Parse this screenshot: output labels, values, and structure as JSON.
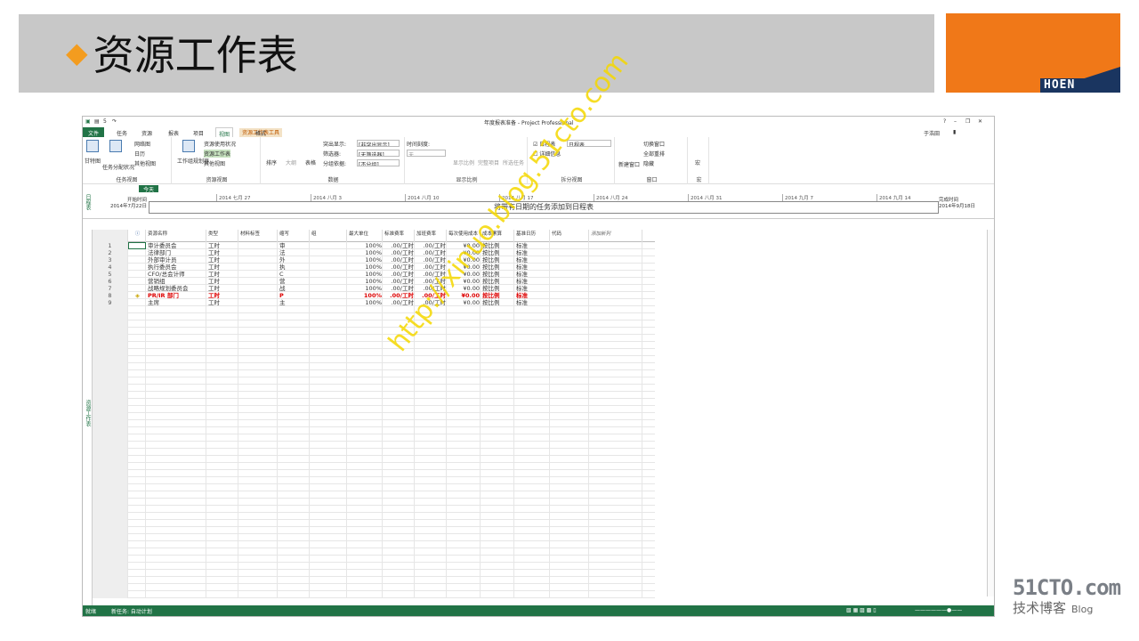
{
  "slide_title": "资源工作表",
  "logo_text": "HOEN",
  "window": {
    "title": "年度报表准备 - Project Professional",
    "help": "?",
    "user": "于浩田",
    "qat_undo": "5",
    "context_tab": "资源工作表工具"
  },
  "tabs": [
    "文件",
    "任务",
    "资源",
    "报表",
    "项目",
    "视图",
    "格式"
  ],
  "active_tab": "视图",
  "ribbon": {
    "groups": [
      {
        "label": "任务视图",
        "items": [
          "甘特图",
          "任务分配状况",
          "网络图",
          "日历",
          "其他视图"
        ]
      },
      {
        "label": "资源视图",
        "items": [
          "工作组规划器",
          "资源使用状况",
          "资源工作表",
          "其他视图"
        ]
      },
      {
        "label": "数据",
        "items": [
          "排序",
          "大纲",
          "表格",
          "突出显示:",
          "筛选器:",
          "分组依据:"
        ]
      },
      {
        "label": "显示比例",
        "items": [
          "时间刻度:",
          "天",
          "显示比例",
          "完整项目",
          "所选任务"
        ]
      },
      {
        "label": "拆分视图",
        "items": [
          "日程表",
          "详细信息"
        ]
      },
      {
        "label": "窗口",
        "items": [
          "新建窗口",
          "切换窗口",
          "全部重排",
          "隐藏"
        ]
      },
      {
        "label": "宏",
        "items": [
          "宏"
        ]
      }
    ],
    "highlight_value": "[非突出显示]",
    "filter_value": "[无筛选器]",
    "group_value": "[不分组]",
    "timeline_value": "日程表"
  },
  "timeline": {
    "today": "今天",
    "start_label": "开始时间",
    "start_date": "2014年7月22日",
    "end_label": "完成时间",
    "end_date": "2014年9月18日",
    "placeholder": "将带有日期的任务添加到日程表",
    "ticks": [
      "2014 七月 27",
      "2014 八月 3",
      "2014 八月 10",
      "2014 八月 17",
      "2014 八月 24",
      "2014 八月 31",
      "2014 九月 7",
      "2014 九月 14"
    ],
    "side_label": "日程表"
  },
  "sheet": {
    "side_label": "资源工作表",
    "columns": [
      "资源名称",
      "类型",
      "材料标签",
      "缩写",
      "组",
      "最大单位",
      "标准费率",
      "加班费率",
      "每次使用成本",
      "成本累算",
      "基准日历",
      "代码",
      "添加新列"
    ],
    "rows": [
      {
        "id": "1",
        "name": "审计委员会",
        "type": "工时",
        "abbr": "审",
        "max": "100%",
        "std": ".00/工时",
        "ot": ".00/工时",
        "cost": "¥0.00",
        "accrue": "按比例",
        "cal": "标准",
        "alert": false
      },
      {
        "id": "2",
        "name": "法律部门",
        "type": "工时",
        "abbr": "法",
        "max": "100%",
        "std": ".00/工时",
        "ot": ".00/工时",
        "cost": "¥0.00",
        "accrue": "按比例",
        "cal": "标准",
        "alert": false
      },
      {
        "id": "3",
        "name": "外部审计员",
        "type": "工时",
        "abbr": "外",
        "max": "100%",
        "std": ".00/工时",
        "ot": ".00/工时",
        "cost": "¥0.00",
        "accrue": "按比例",
        "cal": "标准",
        "alert": false
      },
      {
        "id": "4",
        "name": "执行委员会",
        "type": "工时",
        "abbr": "执",
        "max": "100%",
        "std": ".00/工时",
        "ot": ".00/工时",
        "cost": "¥0.00",
        "accrue": "按比例",
        "cal": "标准",
        "alert": false
      },
      {
        "id": "5",
        "name": "CFO/总会计师",
        "type": "工时",
        "abbr": "C",
        "max": "100%",
        "std": ".00/工时",
        "ot": ".00/工时",
        "cost": "¥0.00",
        "accrue": "按比例",
        "cal": "标准",
        "alert": false
      },
      {
        "id": "6",
        "name": "营销组",
        "type": "工时",
        "abbr": "营",
        "max": "100%",
        "std": ".00/工时",
        "ot": ".00/工时",
        "cost": "¥0.00",
        "accrue": "按比例",
        "cal": "标准",
        "alert": false
      },
      {
        "id": "7",
        "name": "战略规划委员会",
        "type": "工时",
        "abbr": "战",
        "max": "100%",
        "std": ".00/工时",
        "ot": ".00/工时",
        "cost": "¥0.00",
        "accrue": "按比例",
        "cal": "标准",
        "alert": false
      },
      {
        "id": "8",
        "name": "PR/IR 部门",
        "type": "工时",
        "abbr": "P",
        "max": "100%",
        "std": ".00/工时",
        "ot": ".00/工时",
        "cost": "¥0.00",
        "accrue": "按比例",
        "cal": "标准",
        "alert": true
      },
      {
        "id": "9",
        "name": "主席",
        "type": "工时",
        "abbr": "主",
        "max": "100%",
        "std": ".00/工时",
        "ot": ".00/工时",
        "cost": "¥0.00",
        "accrue": "按比例",
        "cal": "标准",
        "alert": false
      }
    ]
  },
  "status": {
    "ready": "就绪",
    "new_task": "新任务: 自动计划"
  },
  "watermark": "http://xinuo.blog.51cto.com",
  "blog": {
    "brand": "51CTO.com",
    "sub": "技术博客",
    "tag": "Blog"
  },
  "colors": {
    "accent": "#217346",
    "orange": "#f07818",
    "navy": "#1a3560",
    "alert_red": "#dd0000"
  }
}
